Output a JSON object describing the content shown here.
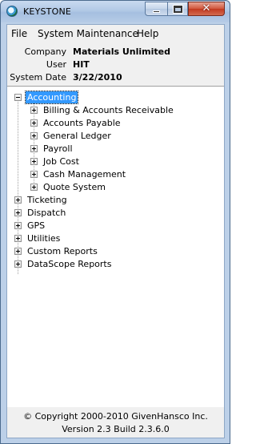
{
  "window": {
    "title": "KEYSTONE",
    "close_glyph": "✕"
  },
  "menu": {
    "items": [
      "File",
      "System Maintenance",
      "Help"
    ]
  },
  "info": {
    "company_label": "Company",
    "company_value": "Materials Unlimited",
    "user_label": "User",
    "user_value": "HIT",
    "date_label": "System Date",
    "date_value": "3/22/2010"
  },
  "tree": {
    "root": {
      "label": "Accounting",
      "children": [
        "Billing & Accounts Receivable",
        "Accounts Payable",
        "General Ledger",
        "Payroll",
        "Job Cost",
        "Cash Management",
        "Quote System"
      ]
    },
    "siblings": [
      "Ticketing",
      "Dispatch",
      "GPS",
      "Utilities",
      "Custom Reports",
      "DataScope Reports"
    ]
  },
  "footer": {
    "copyright": "© Copyright 2000-2010 GivenHansco Inc.",
    "version": "Version 2.3 Build 2.3.6.0"
  }
}
